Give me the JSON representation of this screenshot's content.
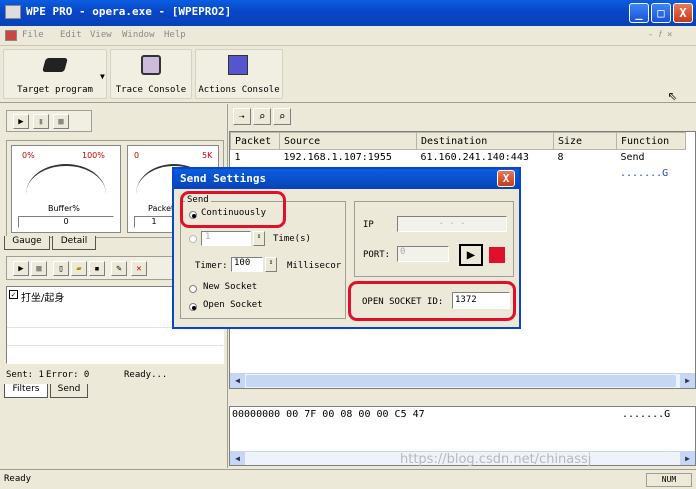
{
  "window": {
    "title": "WPE PRO - opera.exe - [WPEPRO2]",
    "min": "_",
    "max": "□",
    "close": "X"
  },
  "menu": [
    "File",
    "Edit",
    "View",
    "Window",
    "Help"
  ],
  "mdi_controls": "- 𝑓 ×",
  "toolbar": {
    "target": "Target program",
    "trace": "Trace Console",
    "actions": "Actions Console"
  },
  "gauges": [
    {
      "low": "0%",
      "high": "100%",
      "label": "Buffer%",
      "value": "0"
    },
    {
      "low": "0",
      "high": "5K",
      "label": "Packet",
      "value": "1"
    }
  ],
  "tabs_top": [
    "Gauge",
    "Detail"
  ],
  "filter_item": "打坐/起身",
  "status_small": {
    "sent": "Sent: 1",
    "error": "Error: 0",
    "ready": "Ready..."
  },
  "tabs_bottom": [
    "Filters",
    "Send"
  ],
  "packet_table": {
    "headers": [
      "Packet",
      "Source",
      "Destination",
      "Size",
      "Function"
    ],
    "rows": [
      [
        "1",
        "192.168.1.107:1955",
        "61.160.241.140:443",
        "8",
        "Send"
      ]
    ],
    "ascii_row": ".......G"
  },
  "hex": {
    "line": "00000000 00 7F 00 08 00 00 C5 47",
    "ascii": ".......G"
  },
  "dialog": {
    "title": "Send Settings",
    "close": "X",
    "group": "Send",
    "continuously": "Continuously",
    "times_value": "1",
    "times_label": "Time(s)",
    "timer_label": "Timer:",
    "timer_value": "100",
    "ms_label": "Millisecor",
    "new_socket": "New Socket",
    "open_socket": "Open Socket",
    "ip_label": "IP",
    "ip_value": ". . .",
    "port_label": "PORT:",
    "port_value": "0",
    "open_socket_id_label": "OPEN SOCKET ID:",
    "open_socket_id_value": "1372"
  },
  "statusbar": {
    "left": "Ready",
    "right": "NUM"
  },
  "watermark": "https://blog.csdn.net/chinassj",
  "colors": {
    "accent": "#0845c9",
    "highlight": "#e0102a"
  }
}
